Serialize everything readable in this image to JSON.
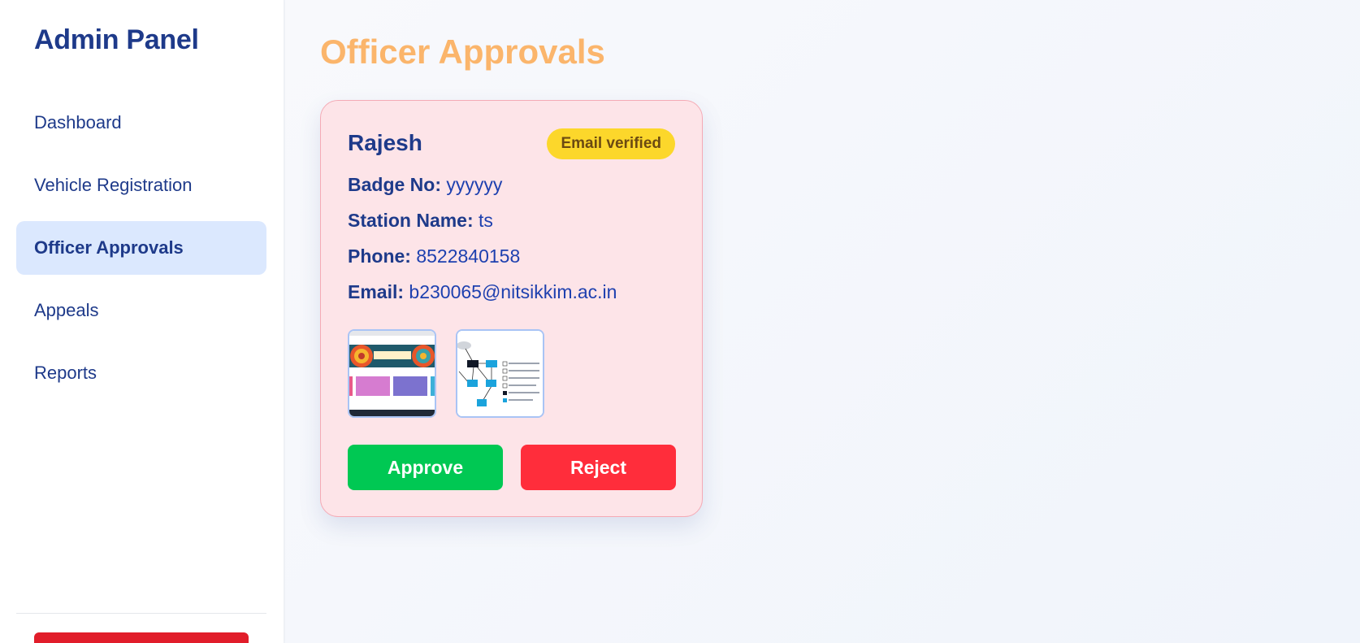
{
  "sidebar": {
    "brand": "Admin Panel",
    "items": [
      {
        "label": "Dashboard",
        "active": false
      },
      {
        "label": "Vehicle Registration",
        "active": false
      },
      {
        "label": "Officer Approvals",
        "active": true
      },
      {
        "label": "Appeals",
        "active": false
      },
      {
        "label": "Reports",
        "active": false
      }
    ]
  },
  "main": {
    "title": "Officer Approvals",
    "card": {
      "name": "Rajesh",
      "status_badge": "Email verified",
      "fields": [
        {
          "label": "Badge No:",
          "value": "yyyyyy"
        },
        {
          "label": "Station Name:",
          "value": "ts"
        },
        {
          "label": "Phone:",
          "value": "8522840158"
        },
        {
          "label": "Email:",
          "value": "b230065@nitsikkim.ac.in"
        }
      ],
      "documents": [
        "document-thumbnail-1",
        "document-thumbnail-2"
      ],
      "approve_label": "Approve",
      "reject_label": "Reject"
    }
  },
  "colors": {
    "brand": "#1e3a8a",
    "title_accent": "#fbb56b",
    "card_bg": "#fde4e8",
    "badge_bg": "#fcd72b",
    "approve": "#00c853",
    "reject": "#ff2d3b",
    "logout": "#e11d2a"
  }
}
